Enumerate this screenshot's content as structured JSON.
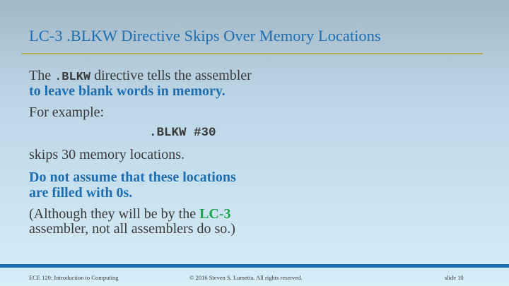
{
  "slide": {
    "title": "LC-3 .BLKW Directive Skips Over Memory Locations",
    "para1": {
      "prefix": "The ",
      "code": ".BLKW",
      "suffix": " directive tells the assembler",
      "highlight": "to leave blank words in memory."
    },
    "for_example": "For example:",
    "code_line": ".BLKW #30",
    "skips": "skips 30 memory locations.",
    "warning_line1": "Do not assume that these locations",
    "warning_line2": "are filled with 0s.",
    "note": {
      "prefix": "(Although they will be by the ",
      "highlight": "LC-3",
      "line2": "assembler, not all assemblers do so.)"
    }
  },
  "footer": {
    "course": "ECE 120: Introduction to Computing",
    "copyright": "© 2016 Steven S. Lumetta.  All rights reserved.",
    "slide_number": "slide 10"
  },
  "colors": {
    "title_blue": "#1e6eb2",
    "highlight_green": "#1aa34a",
    "rule_olive": "#b5b04e"
  }
}
